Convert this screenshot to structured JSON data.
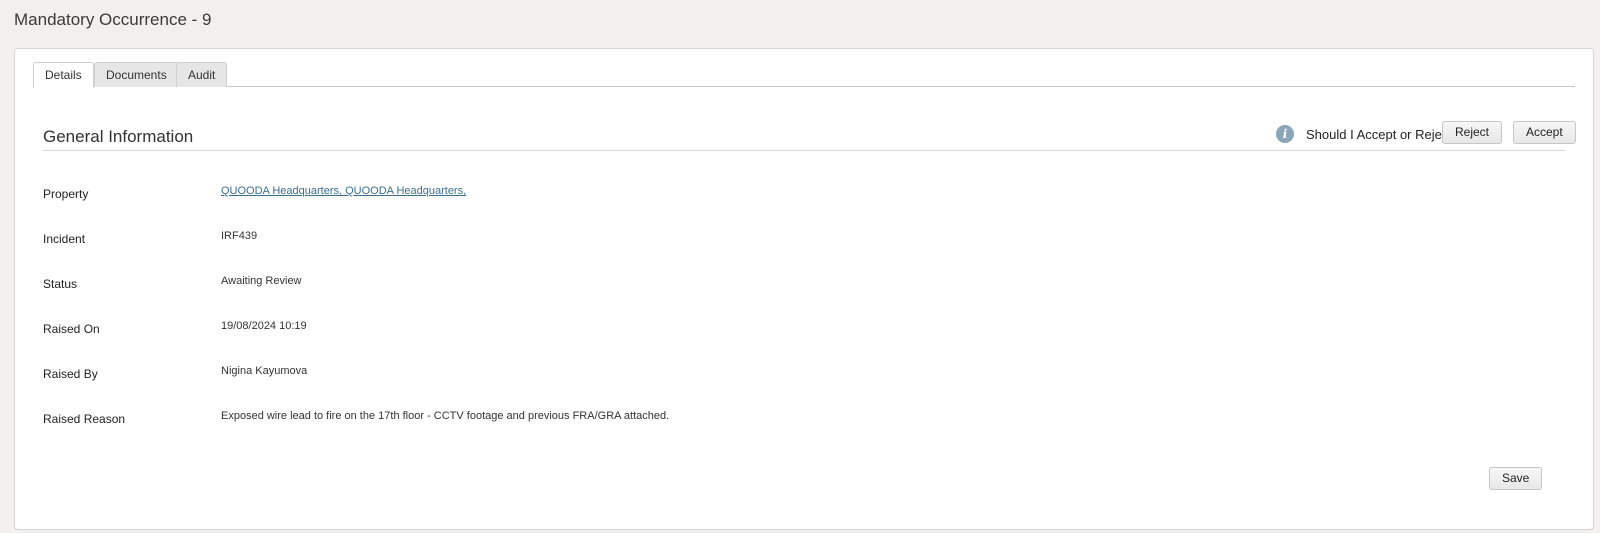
{
  "page": {
    "title": "Mandatory Occurrence - 9"
  },
  "tabs": [
    {
      "label": "Details",
      "active": true
    },
    {
      "label": "Documents",
      "active": false
    },
    {
      "label": "Audit",
      "active": false
    }
  ],
  "section": {
    "title": "General Information",
    "info_icon": "info-icon",
    "question": "Should I Accept or Reject?",
    "reject_label": "Reject",
    "accept_label": "Accept"
  },
  "fields": [
    {
      "label": "Property",
      "value": "QUOODA Headquarters, QUOODA Headquarters,",
      "link": true
    },
    {
      "label": "Incident",
      "value": "IRF439"
    },
    {
      "label": "Status",
      "value": "Awaiting Review"
    },
    {
      "label": "Raised On",
      "value": "19/08/2024 10:19"
    },
    {
      "label": "Raised By",
      "value": "Nigina Kayumova"
    },
    {
      "label": "Raised Reason",
      "value": "Exposed wire lead to fire on the 17th floor - CCTV footage and previous FRA/GRA attached."
    }
  ],
  "footer": {
    "save_label": "Save"
  },
  "colors": {
    "link": "#3a6f93",
    "background": "#f1f0ef",
    "panel": "#ffffff"
  }
}
